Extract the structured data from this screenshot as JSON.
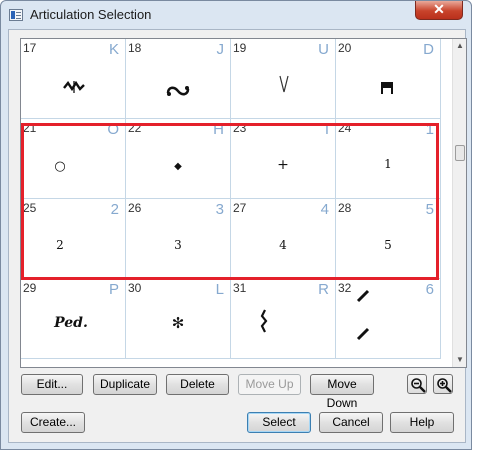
{
  "window": {
    "title": "Articulation Selection",
    "close_glyph": "✕"
  },
  "articulations": [
    {
      "number": "17",
      "key": "K",
      "symbol": "mordent-icon"
    },
    {
      "number": "18",
      "key": "J",
      "symbol": "turn-icon"
    },
    {
      "number": "19",
      "key": "U",
      "symbol": "up-bow-icon"
    },
    {
      "number": "20",
      "key": "D",
      "symbol": "down-bow-icon"
    },
    {
      "number": "21",
      "key": "O",
      "glyph": "○"
    },
    {
      "number": "22",
      "key": "H",
      "glyph": "◆"
    },
    {
      "number": "23",
      "key": "I",
      "glyph": "+"
    },
    {
      "number": "24",
      "key": "1",
      "glyph": "1"
    },
    {
      "number": "25",
      "key": "2",
      "glyph": "2"
    },
    {
      "number": "26",
      "key": "3",
      "glyph": "3"
    },
    {
      "number": "27",
      "key": "4",
      "glyph": "4"
    },
    {
      "number": "28",
      "key": "5",
      "glyph": "5"
    },
    {
      "number": "29",
      "key": "P",
      "glyph": "Ped."
    },
    {
      "number": "30",
      "key": "L",
      "glyph": "✻"
    },
    {
      "number": "31",
      "key": "R",
      "symbol": "squiggle-icon"
    },
    {
      "number": "32",
      "key": "6",
      "symbol": "slash-marks-icon"
    }
  ],
  "toolbar": {
    "edit": "Edit...",
    "duplicate": "Duplicate",
    "delete": "Delete",
    "move_up": "Move Up",
    "move_down": "Move Down"
  },
  "footer": {
    "create": "Create...",
    "select": "Select",
    "cancel": "Cancel",
    "help": "Help"
  },
  "colors": {
    "selection_border": "#e4202a",
    "key_letter": "#86a9cf"
  }
}
